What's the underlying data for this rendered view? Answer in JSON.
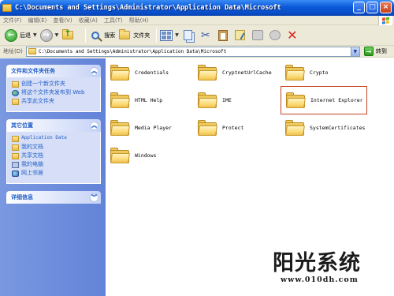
{
  "window": {
    "title": "C:\\Documents and Settings\\Administrator\\Application Data\\Microsoft",
    "controls": {
      "minimize": "_",
      "maximize": "□",
      "close": "×"
    }
  },
  "menu": [
    "文件(F)",
    "编辑(E)",
    "查看(V)",
    "收藏(A)",
    "工具(T)",
    "帮助(H)"
  ],
  "toolbar": {
    "back": "后退",
    "search": "搜索",
    "folders": "文件夹"
  },
  "address": {
    "label": "地址(D)",
    "value": "C:\\Documents and Settings\\Administrator\\Application Data\\Microsoft",
    "go": "转到"
  },
  "taskpane": {
    "file_tasks": {
      "title": "文件和文件夹任务",
      "items": [
        "创建一个新文件夹",
        "将这个文件夹发布到 Web",
        "共享此文件夹"
      ]
    },
    "other_places": {
      "title": "其它位置",
      "items": [
        "Application Data",
        "我的文档",
        "共享文档",
        "我的电脑",
        "网上邻居"
      ]
    },
    "details": {
      "title": "详细信息"
    }
  },
  "folders": [
    {
      "name": "Credentials"
    },
    {
      "name": "CryptnetUrlCache"
    },
    {
      "name": "Crypto"
    },
    {
      "name": "HTML Help"
    },
    {
      "name": "IME"
    },
    {
      "name": "Internet Explorer",
      "selected": true
    },
    {
      "name": "Media Player"
    },
    {
      "name": "Protect"
    },
    {
      "name": "SystemCertificates"
    },
    {
      "name": "Windows"
    }
  ],
  "watermark": {
    "title": "阳光系统",
    "url": "www.010dh.com"
  }
}
